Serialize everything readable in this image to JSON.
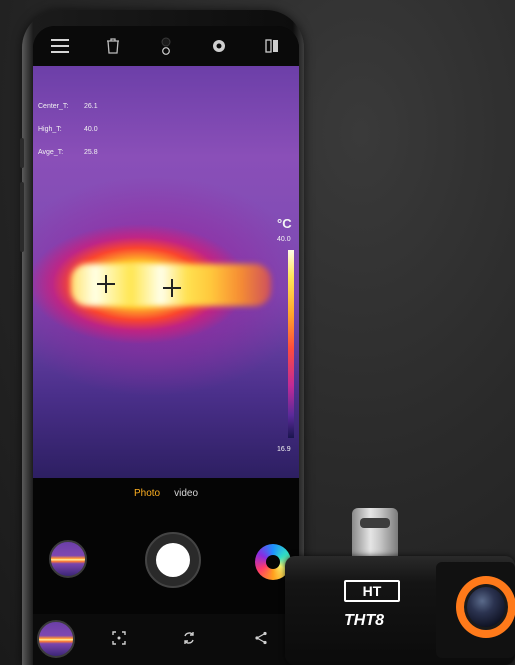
{
  "readouts": [
    {
      "label": "Center_T:",
      "value": "26.1"
    },
    {
      "label": "High_T:",
      "value": "40.0"
    },
    {
      "label": "Avge_T:",
      "value": "25.8"
    }
  ],
  "scale": {
    "unit": "°C",
    "max": "40.0",
    "min": "16.9"
  },
  "modes": {
    "photo": "Photo",
    "video": "video"
  },
  "device": {
    "brand": "HT",
    "model": "THT8"
  },
  "colors": {
    "accent": "#ffb020",
    "lens_ring": "#ff7a1a"
  },
  "icons": {
    "menu": "menu-icon",
    "delete": "trash-icon",
    "settings": "gear-icon",
    "mirror": "mirror-icon",
    "focus": "focus-frame-icon",
    "rotate": "rotate-icon",
    "share": "share-icon"
  }
}
